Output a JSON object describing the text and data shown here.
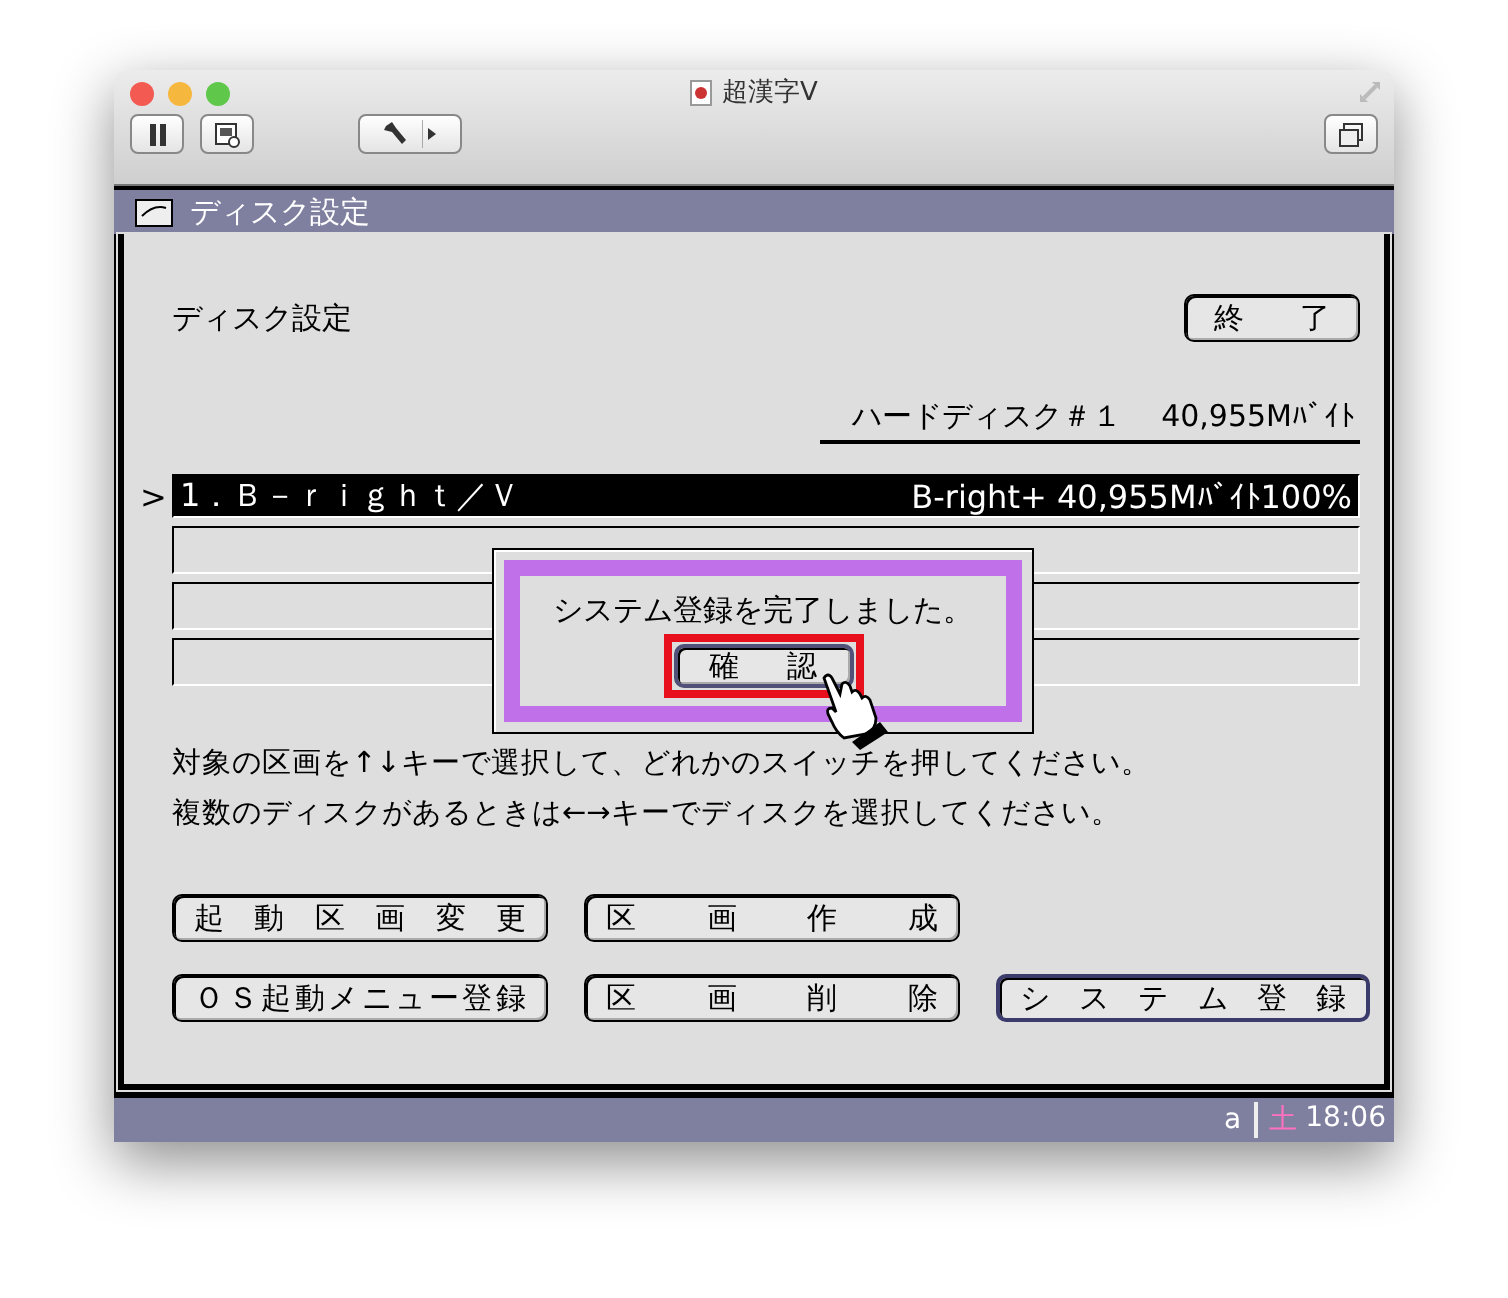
{
  "window": {
    "title": "超漢字V"
  },
  "toolbar": [
    {
      "kind": "pause"
    },
    {
      "kind": "screen"
    },
    {
      "kind": "tools"
    },
    {
      "kind": "windows"
    }
  ],
  "panel": {
    "title": "ディスク設定"
  },
  "heading": "ディスク設定",
  "close_button": "終　了",
  "disk_label": "ハードディスク＃１　 40,955Mﾊﾞｲﾄ",
  "partitions": [
    {
      "pointer": ">",
      "name": "1．Ｂ－ｒｉｇｈｔ／Ｖ",
      "info": "B-right+ 40,955Mﾊﾞｲﾄ100%",
      "selected": true
    },
    {
      "selected": false
    },
    {
      "selected": false
    },
    {
      "selected": false
    }
  ],
  "instructions": [
    "対象の区画を↑↓キーで選択して、どれかのスイッチを押してください。",
    "複数のディスクがあるときは←→キーでディスクを選択してください。"
  ],
  "buttons": [
    {
      "label": "起動区画変更",
      "selected": false
    },
    {
      "label": "区画作成",
      "selected": false
    },
    {
      "label": "ＯＳ起動メニュー登録",
      "selected": false
    },
    {
      "label": "区画削除",
      "selected": false
    },
    {
      "label": "システム登録",
      "selected": true
    }
  ],
  "dialog": {
    "message": "システム登録を完了しました。",
    "button": "確　認"
  },
  "status_bar": {
    "input_mode": "a",
    "day": "土",
    "time": "18:06"
  }
}
